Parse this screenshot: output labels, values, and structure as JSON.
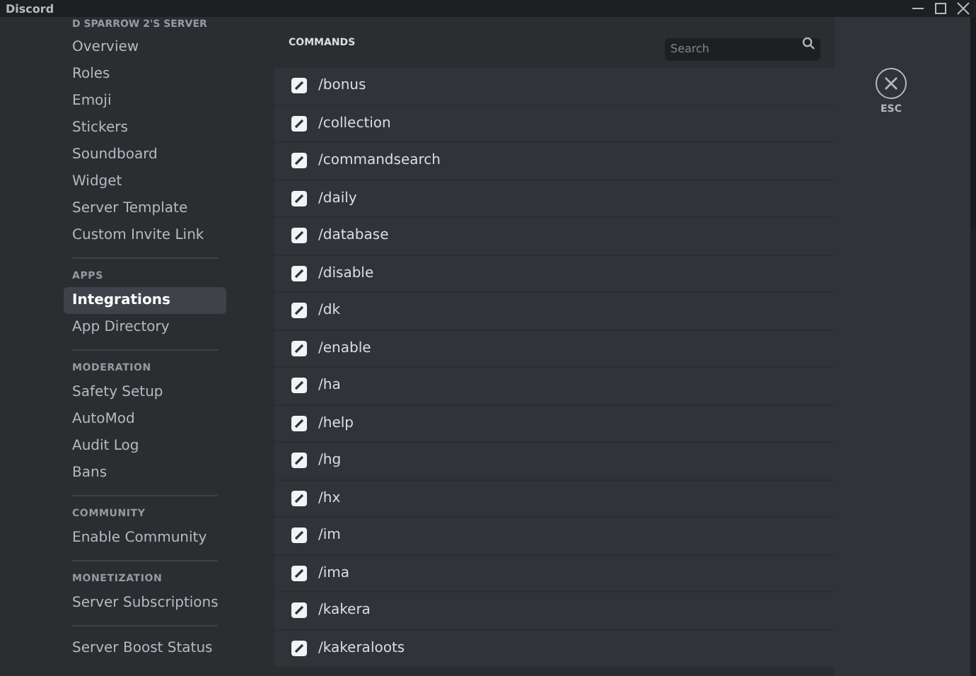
{
  "window": {
    "title": "Discord"
  },
  "sidebar": {
    "server_name": "D SPARROW 2'S SERVER",
    "sections": [
      {
        "items": [
          {
            "label": "Overview",
            "selected": false
          },
          {
            "label": "Roles",
            "selected": false
          },
          {
            "label": "Emoji",
            "selected": false
          },
          {
            "label": "Stickers",
            "selected": false
          },
          {
            "label": "Soundboard",
            "selected": false
          },
          {
            "label": "Widget",
            "selected": false
          },
          {
            "label": "Server Template",
            "selected": false
          },
          {
            "label": "Custom Invite Link",
            "selected": false
          }
        ]
      },
      {
        "heading": "APPS",
        "items": [
          {
            "label": "Integrations",
            "selected": true
          },
          {
            "label": "App Directory",
            "selected": false
          }
        ]
      },
      {
        "heading": "MODERATION",
        "items": [
          {
            "label": "Safety Setup",
            "selected": false
          },
          {
            "label": "AutoMod",
            "selected": false
          },
          {
            "label": "Audit Log",
            "selected": false
          },
          {
            "label": "Bans",
            "selected": false
          }
        ]
      },
      {
        "heading": "COMMUNITY",
        "items": [
          {
            "label": "Enable Community",
            "selected": false
          }
        ]
      },
      {
        "heading": "MONETIZATION",
        "items": [
          {
            "label": "Server Subscriptions",
            "selected": false
          }
        ]
      }
    ],
    "boost_item": {
      "label": "Server Boost Status"
    }
  },
  "commands": {
    "heading": "COMMANDS",
    "search": {
      "placeholder": "Search"
    },
    "items": [
      {
        "name": "/bonus",
        "checked": true
      },
      {
        "name": "/collection",
        "checked": true
      },
      {
        "name": "/commandsearch",
        "checked": true
      },
      {
        "name": "/daily",
        "checked": true
      },
      {
        "name": "/database",
        "checked": true
      },
      {
        "name": "/disable",
        "checked": true
      },
      {
        "name": "/dk",
        "checked": true
      },
      {
        "name": "/enable",
        "checked": true
      },
      {
        "name": "/ha",
        "checked": true
      },
      {
        "name": "/help",
        "checked": true
      },
      {
        "name": "/hg",
        "checked": true
      },
      {
        "name": "/hx",
        "checked": true
      },
      {
        "name": "/im",
        "checked": true
      },
      {
        "name": "/ima",
        "checked": true
      },
      {
        "name": "/kakera",
        "checked": true
      },
      {
        "name": "/kakeraloots",
        "checked": true
      }
    ]
  },
  "close": {
    "label": "ESC"
  }
}
